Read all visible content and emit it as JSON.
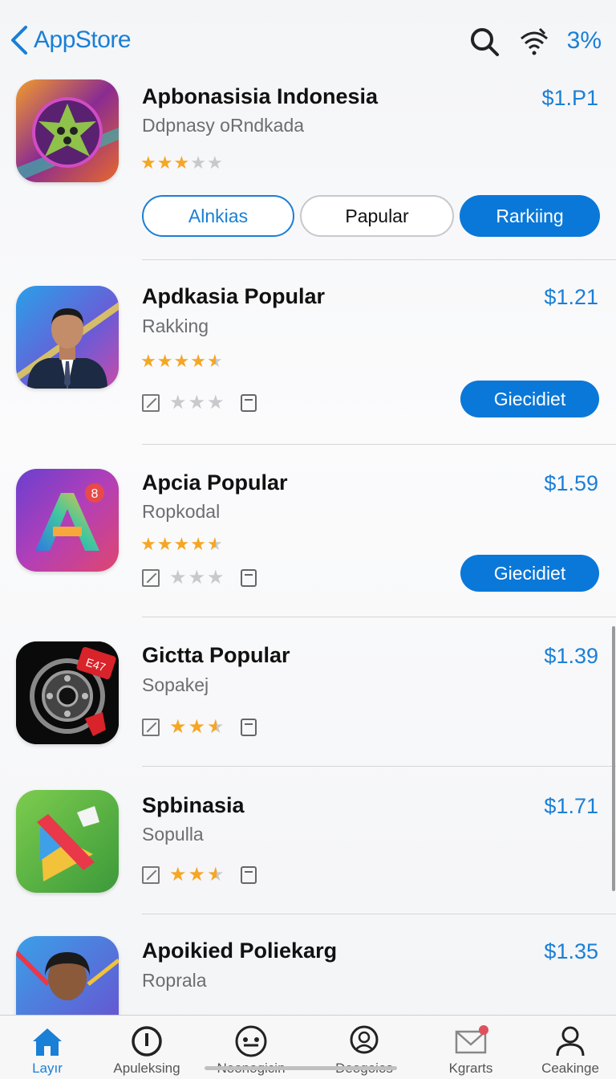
{
  "header": {
    "back_label": "AppStore",
    "status_percent": "3%"
  },
  "featured": {
    "title": "Apbonasisia Indonesia",
    "subtitle": "Ddpnasy oRndkada",
    "price": "$1.P1",
    "rating_stars": 3,
    "segments": [
      "Alnkias",
      "Papular",
      "Rarkiing"
    ]
  },
  "apps": [
    {
      "title": "Apdkasia Popular",
      "subtitle": "Rakking",
      "price": "$1.21",
      "rating": 4.5,
      "meta_stars": 0,
      "button": "Giecidiet"
    },
    {
      "title": "Apcia Popular",
      "subtitle": "Ropkodal",
      "price": "$1.59",
      "rating": 4.5,
      "meta_stars": 0,
      "button": "Giecidiet"
    },
    {
      "title": "Gictta Popular",
      "subtitle": "Sopakej",
      "price": "$1.39",
      "meta_stars": 2.5
    },
    {
      "title": "Spbinasia",
      "subtitle": "Sopulla",
      "price": "$1.71",
      "meta_stars": 2.5
    },
    {
      "title": "Apoikied Poliekarg",
      "subtitle": "Roprala",
      "price": "$1.35"
    }
  ],
  "tabs": [
    {
      "label": "Layır",
      "icon": "home-icon",
      "active": true
    },
    {
      "label": "Apuleksing",
      "icon": "clock-icon",
      "active": false
    },
    {
      "label": "Noonogicin",
      "icon": "face-icon",
      "active": false
    },
    {
      "label": "Deogoios",
      "icon": "search-person-icon",
      "active": false
    },
    {
      "label": "Kgrarts",
      "icon": "mail-icon",
      "active": false
    },
    {
      "label": "Ceakinge",
      "icon": "person-icon",
      "active": false
    }
  ],
  "colors": {
    "accent": "#0a78d8",
    "star": "#f5a623",
    "badge": "#e0505e"
  }
}
